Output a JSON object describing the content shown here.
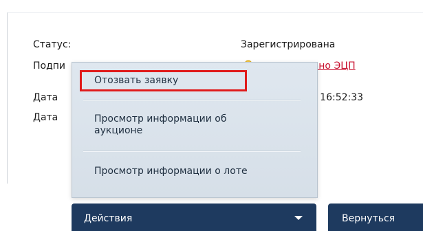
{
  "details": {
    "status_label": "Статус:",
    "status_value": "Зарегистрирована",
    "signed_label": "Подпи",
    "signed_value": "сано ЭЦП",
    "date1_label": "Дата",
    "date1_value": ": 16:52:33",
    "date2_label": "Дата"
  },
  "menu": {
    "items": [
      {
        "label": "Отозвать заявку"
      },
      {
        "label": "Просмотр информации об аукционе"
      },
      {
        "label": "Просмотр информации о лоте"
      }
    ]
  },
  "buttons": {
    "actions_label": "Действия",
    "back_label": "Вернуться"
  },
  "icons": {
    "sign_icon": "signature-icon",
    "dropdown_caret": "chevron-down-icon"
  },
  "colors": {
    "primary_button": "#1e3a5f",
    "link_red": "#c8102e",
    "highlight_frame": "#e01b1b"
  }
}
